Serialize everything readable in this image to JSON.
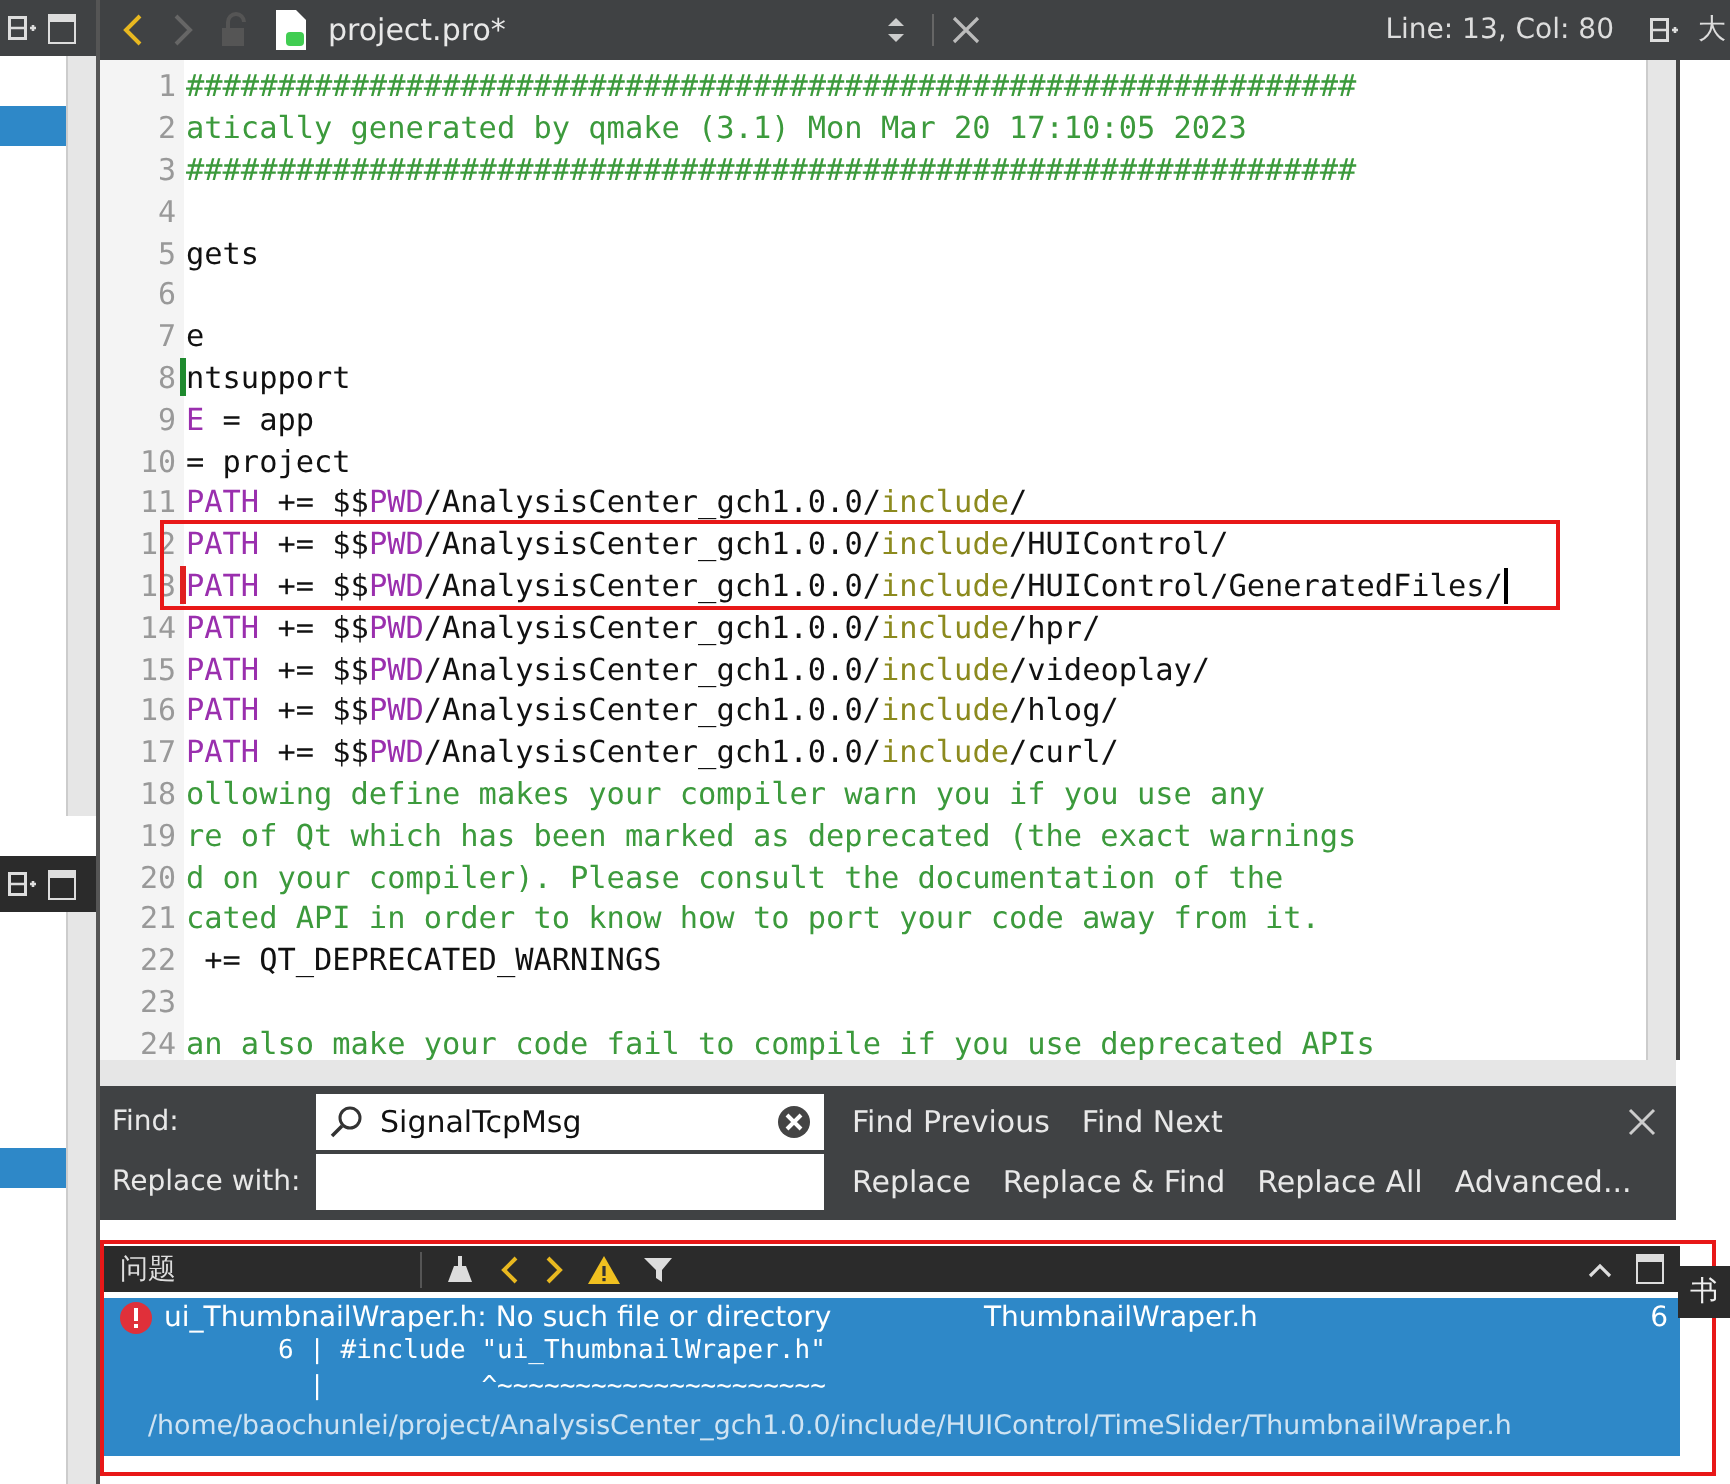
{
  "left_panes": [
    {
      "has_selection": true
    },
    {
      "has_selection": true
    }
  ],
  "editor_toolbar": {
    "back_enabled": true,
    "forward_enabled": false,
    "file_name": "project.pro*",
    "position": "Line: 13, Col: 80",
    "side_title": "大"
  },
  "editor": {
    "lines": [
      {
        "number": "1",
        "segments": [
          {
            "kind": "comment",
            "text": "################################################################"
          }
        ]
      },
      {
        "number": "2",
        "segments": [
          {
            "kind": "comment",
            "text": "atically generated by qmake (3.1) Mon Mar 20 17:10:05 2023"
          }
        ]
      },
      {
        "number": "3",
        "segments": [
          {
            "kind": "comment",
            "text": "################################################################"
          }
        ]
      },
      {
        "number": "4"
      },
      {
        "number": "5",
        "segments": [
          {
            "kind": "plain",
            "text": "gets"
          }
        ]
      },
      {
        "number": "6"
      },
      {
        "number": "7",
        "segments": [
          {
            "kind": "plain",
            "text": "e"
          }
        ]
      },
      {
        "number": "8",
        "color": "#1e8a2e",
        "segments": [
          {
            "kind": "plain",
            "text": "ntsupport"
          }
        ]
      },
      {
        "number": "9",
        "segments": [
          {
            "kind": "keyword",
            "text": "E"
          },
          {
            "kind": "plain",
            "text": " = app"
          }
        ]
      },
      {
        "number": "10",
        "segments": [
          {
            "kind": "plain",
            "text": "= project"
          }
        ]
      },
      {
        "number": "11",
        "segments": [
          {
            "kind": "keyword",
            "text": "PATH"
          },
          {
            "kind": "plain",
            "text": " += $$"
          },
          {
            "kind": "keyword",
            "text": "PWD"
          },
          {
            "kind": "plain",
            "text": "/AnalysisCenter_gch1.0.0/"
          },
          {
            "kind": "path",
            "text": "include"
          },
          {
            "kind": "plain",
            "text": "/"
          }
        ]
      },
      {
        "number": "12",
        "highlighted": true,
        "segments": [
          {
            "kind": "keyword",
            "text": "PATH"
          },
          {
            "kind": "plain",
            "text": " += $$"
          },
          {
            "kind": "keyword",
            "text": "PWD"
          },
          {
            "kind": "plain",
            "text": "/AnalysisCenter_gch1.0.0/"
          },
          {
            "kind": "path",
            "text": "include"
          },
          {
            "kind": "plain",
            "text": "/HUIControl/"
          }
        ]
      },
      {
        "number": "13",
        "highlighted": true,
        "cursor": true,
        "color": "#e02020",
        "segments": [
          {
            "kind": "keyword",
            "text": "PATH"
          },
          {
            "kind": "plain",
            "text": " += $$"
          },
          {
            "kind": "keyword",
            "text": "PWD"
          },
          {
            "kind": "plain",
            "text": "/AnalysisCenter_gch1.0.0/"
          },
          {
            "kind": "path",
            "text": "include"
          },
          {
            "kind": "plain",
            "text": "/HUIControl/GeneratedFiles/"
          }
        ]
      },
      {
        "number": "14",
        "segments": [
          {
            "kind": "keyword",
            "text": "PATH"
          },
          {
            "kind": "plain",
            "text": " += $$"
          },
          {
            "kind": "keyword",
            "text": "PWD"
          },
          {
            "kind": "plain",
            "text": "/AnalysisCenter_gch1.0.0/"
          },
          {
            "kind": "path",
            "text": "include"
          },
          {
            "kind": "plain",
            "text": "/hpr/"
          }
        ]
      },
      {
        "number": "15",
        "segments": [
          {
            "kind": "keyword",
            "text": "PATH"
          },
          {
            "kind": "plain",
            "text": " += $$"
          },
          {
            "kind": "keyword",
            "text": "PWD"
          },
          {
            "kind": "plain",
            "text": "/AnalysisCenter_gch1.0.0/"
          },
          {
            "kind": "path",
            "text": "include"
          },
          {
            "kind": "plain",
            "text": "/videoplay/"
          }
        ]
      },
      {
        "number": "16",
        "segments": [
          {
            "kind": "keyword",
            "text": "PATH"
          },
          {
            "kind": "plain",
            "text": " += $$"
          },
          {
            "kind": "keyword",
            "text": "PWD"
          },
          {
            "kind": "plain",
            "text": "/AnalysisCenter_gch1.0.0/"
          },
          {
            "kind": "path",
            "text": "include"
          },
          {
            "kind": "plain",
            "text": "/hlog/"
          }
        ]
      },
      {
        "number": "17",
        "segments": [
          {
            "kind": "keyword",
            "text": "PATH"
          },
          {
            "kind": "plain",
            "text": " += $$"
          },
          {
            "kind": "keyword",
            "text": "PWD"
          },
          {
            "kind": "plain",
            "text": "/AnalysisCenter_gch1.0.0/"
          },
          {
            "kind": "path",
            "text": "include"
          },
          {
            "kind": "plain",
            "text": "/curl/"
          }
        ]
      },
      {
        "number": "18",
        "segments": [
          {
            "kind": "comment",
            "text": "ollowing define makes your compiler warn you if you use any"
          }
        ]
      },
      {
        "number": "19",
        "segments": [
          {
            "kind": "comment",
            "text": "re of Qt which has been marked as deprecated (the exact warnings"
          }
        ]
      },
      {
        "number": "20",
        "segments": [
          {
            "kind": "comment",
            "text": "d on your compiler). Please consult the documentation of the"
          }
        ]
      },
      {
        "number": "21",
        "segments": [
          {
            "kind": "comment",
            "text": "cated API in order to know how to port your code away from it."
          }
        ]
      },
      {
        "number": "22",
        "segments": [
          {
            "kind": "plain",
            "text": " += QT_DEPRECATED_WARNINGS"
          }
        ]
      },
      {
        "number": "23"
      },
      {
        "number": "24",
        "segments": [
          {
            "kind": "comment",
            "text": "an also make your code fail to compile if you use deprecated APIs"
          }
        ]
      }
    ]
  },
  "find_bar": {
    "find_label": "Find:",
    "find_value": "SignalTcpMsg",
    "replace_label": "Replace with:",
    "buttons_row1": [
      "Find Previous",
      "Find Next"
    ],
    "buttons_row2": [
      "Replace",
      "Replace & Find",
      "Replace All",
      "Advanced..."
    ]
  },
  "issues_panel": {
    "title": "问题",
    "highlighted": true,
    "tooltip": "书",
    "issues": [
      {
        "kind": "error",
        "selected": true,
        "message": "ui_ThumbnailWraper.h: No such file or directory",
        "file": "ThumbnailWraper.h",
        "line": "6",
        "details": [
          "      6 | #include \"ui_ThumbnailWraper.h\"",
          "        |          ^~~~~~~~~~~~~~~~~~~~~~"
        ],
        "path": "/home/baochunlei/project/AnalysisCenter_gch1.0.0/include/HUIControl/TimeSlider/ThumbnailWraper.h"
      }
    ]
  }
}
